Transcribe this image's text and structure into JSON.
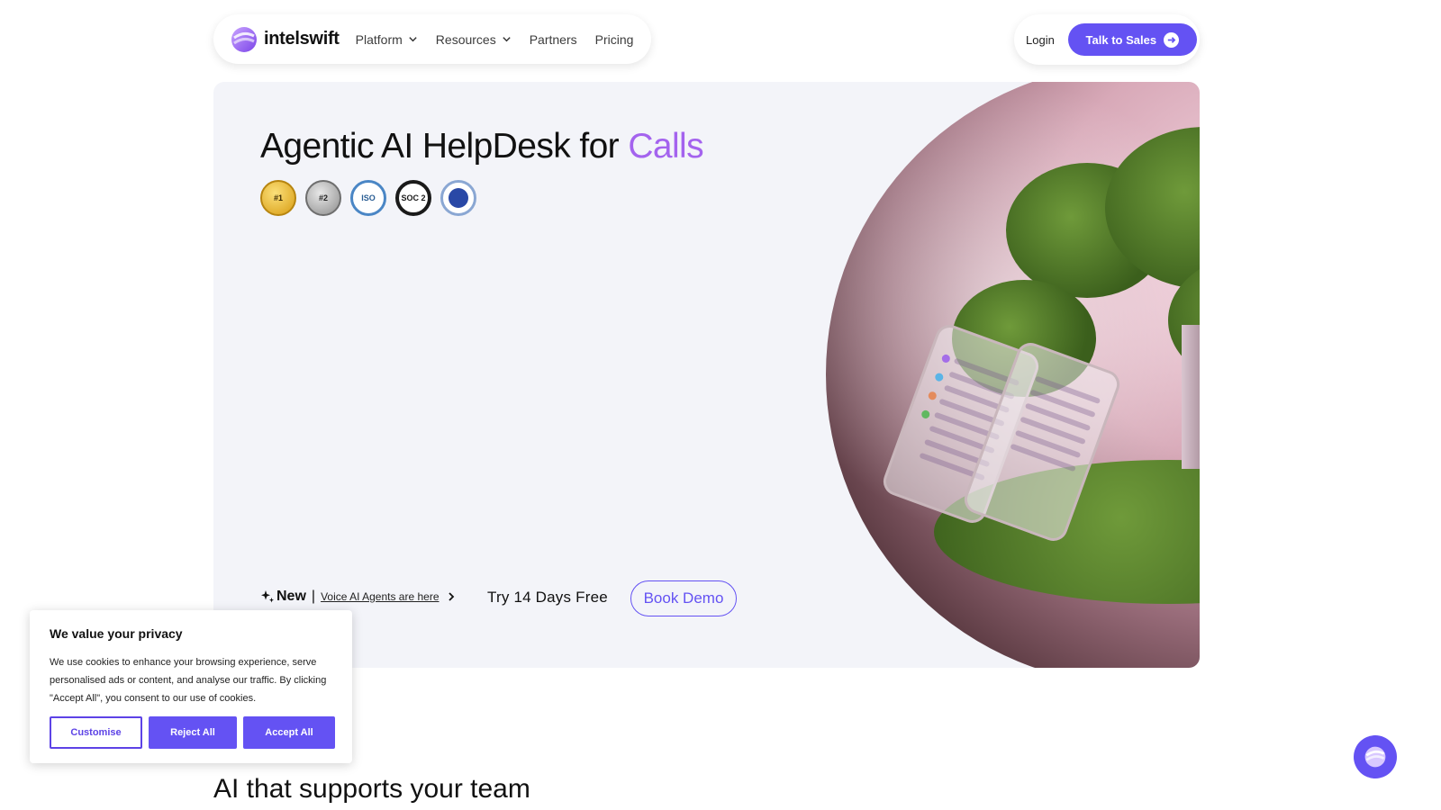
{
  "brand": {
    "name": "intelswift"
  },
  "nav": {
    "items": [
      {
        "label": "Platform",
        "has_dropdown": true
      },
      {
        "label": "Resources",
        "has_dropdown": true
      },
      {
        "label": "Partners",
        "has_dropdown": false
      },
      {
        "label": "Pricing",
        "has_dropdown": false
      }
    ],
    "login": "Login",
    "cta": "Talk to Sales"
  },
  "hero": {
    "title_prefix": "Agentic AI HelpDesk for",
    "title_accent": "Calls",
    "badges": [
      {
        "label": "RANKED #1",
        "icon": "ranked-1-badge"
      },
      {
        "label": "RANKED #2",
        "icon": "ranked-2-badge"
      },
      {
        "label": "ISO 27001",
        "icon": "iso-badge"
      },
      {
        "label": "AICPA SOC 2",
        "icon": "soc2-badge"
      },
      {
        "label": "GDPR",
        "icon": "gdpr-badge"
      }
    ],
    "new_label": "New",
    "separator": "|",
    "voice_link": "Voice AI Agents are here",
    "try_free": "Try 14 Days Free",
    "book_demo": "Book Demo"
  },
  "section": {
    "heading": "AI that supports your team"
  },
  "cookie": {
    "title": "We value your privacy",
    "text": "We use cookies to enhance your browsing experience, serve personalised ads or content, and analyse our traffic. By clicking \"Accept All\", you consent to our use of cookies.",
    "customise": "Customise",
    "reject": "Reject All",
    "accept": "Accept All"
  },
  "colors": {
    "accent": "#6452f3",
    "title_accent": "#a463ee",
    "hero_bg": "#f3f4f9"
  }
}
